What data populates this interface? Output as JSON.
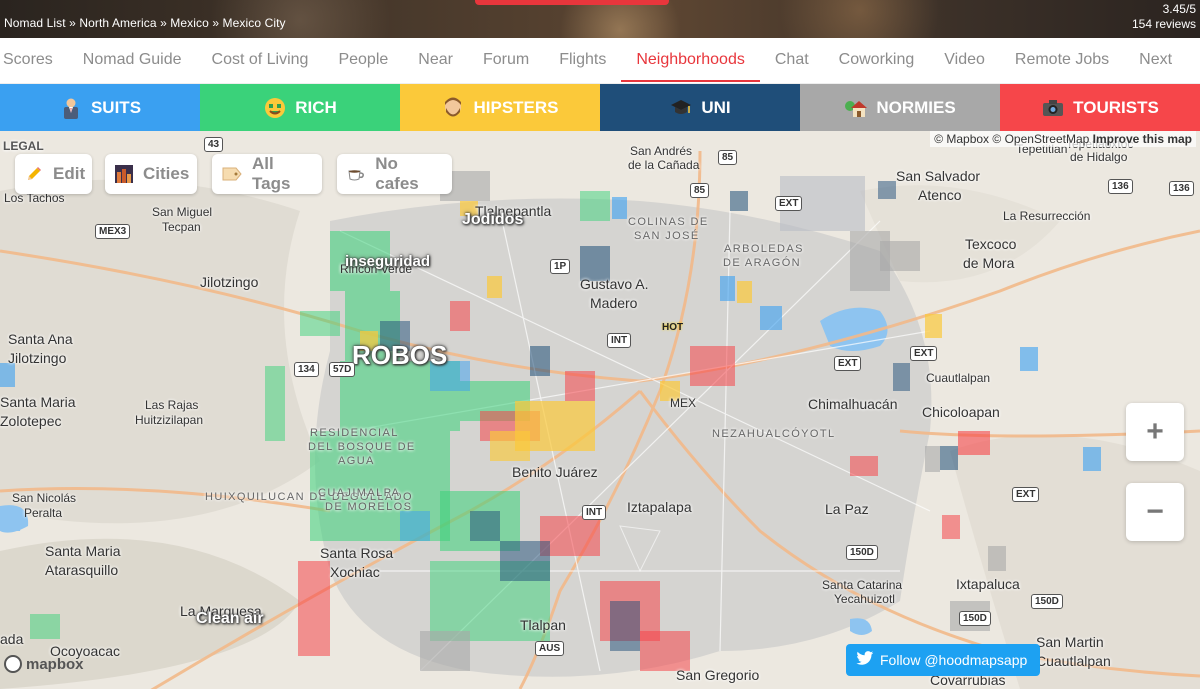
{
  "header": {
    "breadcrumb": "Nomad List » North America » Mexico » Mexico City",
    "rating": "3.45/5",
    "reviews": "154 reviews"
  },
  "tabs": [
    "Scores",
    "Nomad Guide",
    "Cost of Living",
    "People",
    "Near",
    "Forum",
    "Flights",
    "Neighborhoods",
    "Chat",
    "Coworking",
    "Video",
    "Remote Jobs",
    "Next"
  ],
  "active_tab": "Neighborhoods",
  "tribes": [
    {
      "label": "SUITS",
      "color": "#3aa0f1",
      "icon": "businessman-icon"
    },
    {
      "label": "RICH",
      "color": "#3ad27a",
      "icon": "money-face-icon"
    },
    {
      "label": "HIPSTERS",
      "color": "#fbc93a",
      "icon": "bearded-man-icon"
    },
    {
      "label": "UNI",
      "color": "#1f4e79",
      "icon": "graduation-cap-icon"
    },
    {
      "label": "NORMIES",
      "color": "#a8a8a8",
      "icon": "house-icon"
    },
    {
      "label": "TOURISTS",
      "color": "#f6464a",
      "icon": "camera-icon"
    }
  ],
  "filters": {
    "edit": "Edit",
    "cities": "Cities",
    "all_tags": "All Tags",
    "no_cafes": "No cafes"
  },
  "attribution": {
    "mapbox": "© Mapbox",
    "osm": "© OpenStreetMap",
    "improve": "Improve this map"
  },
  "legal": "LEGAL",
  "follow": "Follow @hoodmapsapp",
  "mapbox_logo": "mapbox",
  "zoom": {
    "in": "+",
    "out": "−"
  },
  "tags": [
    "Jodidos",
    "inseguridad",
    "ROBOS",
    "Clean air",
    "HOT"
  ],
  "places": [
    "Los Tachos",
    "San Miguel",
    "Tecpan",
    "Jilotzingo",
    "Santa Ana",
    "Jilotzingo",
    "Santa Maria",
    "Zolotepec",
    "Las Rajas",
    "Huitzizilapan",
    "San Nicolás",
    "Peralta",
    "Santa Maria",
    "Atarasquillo",
    "Santa Rosa",
    "Xochiac",
    "La Marquesa",
    "Ocoyoacac",
    "ada",
    "Tlalnepantla",
    "Rincon Verde",
    "San Andrés",
    "de la Cañada",
    "Gustavo A.",
    "Madero",
    "Benito Juárez",
    "Iztapalapa",
    "Tlalpan",
    "San Gregorio",
    "La Paz",
    "Chimalhuacán",
    "Chicoloapan",
    "Cuautlalpan",
    "Ixtapaluca",
    "Santa Catarina",
    "Yecahuizotl",
    "San Martin",
    "Cuautlalpan",
    "Covarrubias",
    "San Salvador",
    "Atenco",
    "La Resurrección",
    "Texcoco",
    "de Mora",
    "Tepetitlan",
    "Tepetlaoxtoc",
    "de Hidalgo",
    "MEX",
    "NEZAHUALCÓYOTL",
    "ARBOLEDAS",
    "DE ARAGÓN",
    "COLINAS DE",
    "SAN JOSÉ",
    "RESIDENCIAL",
    "DEL BOSQUE DE",
    "AGUA",
    "HUIXQUILUCAN DE DEGOLLADO",
    "CUAJIMALPA",
    "DE MORELOS",
    "Santa Rosa",
    "Lake"
  ],
  "shields": [
    "43",
    "85",
    "85",
    "1P",
    "EXT",
    "MEX3",
    "134",
    "57D",
    "INT",
    "INT",
    "EXT",
    "EXT",
    "EXT",
    "136",
    "136",
    "150D",
    "150D",
    "150D",
    "AUS"
  ]
}
